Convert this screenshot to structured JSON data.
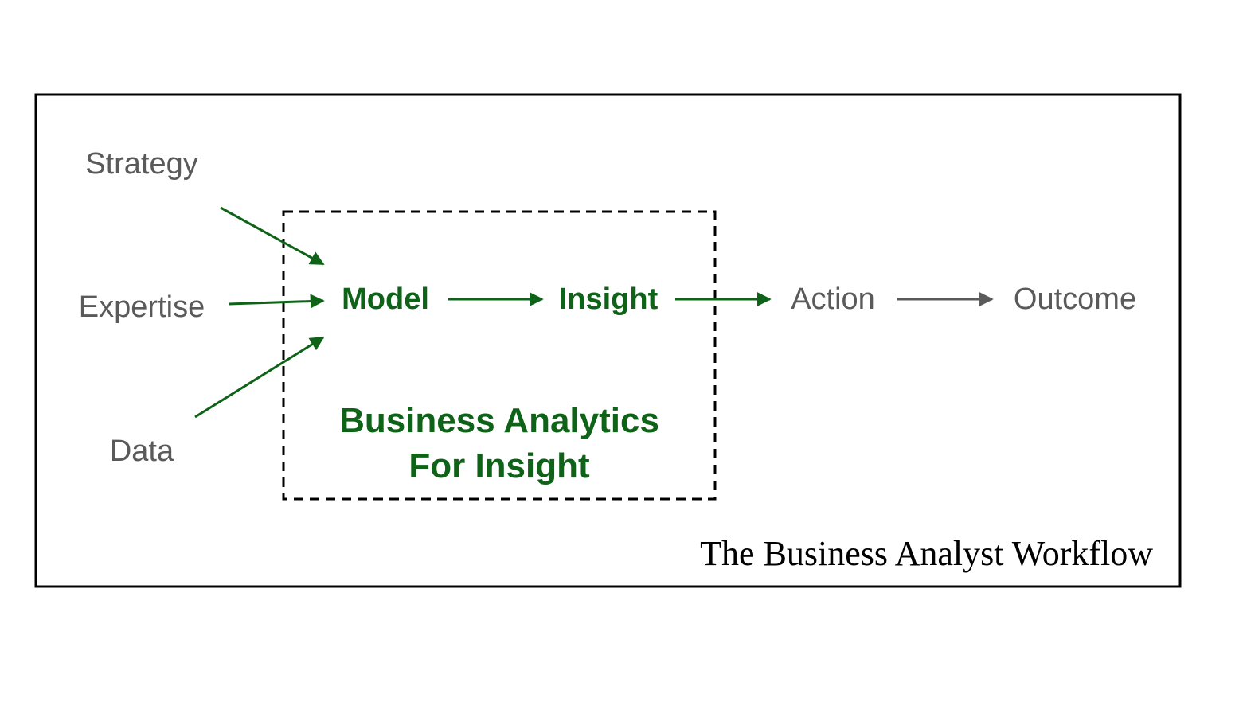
{
  "diagram": {
    "inputs": {
      "strategy": "Strategy",
      "expertise": "Expertise",
      "data": "Data"
    },
    "flow": {
      "model": "Model",
      "insight": "Insight",
      "action": "Action",
      "outcome": "Outcome"
    },
    "box_label": {
      "line1": "Business Analytics",
      "line2": "For Insight"
    },
    "caption": "The Business Analyst Workflow"
  },
  "colors": {
    "green": "#0f6318",
    "gray": "#5a5a5a",
    "black": "#000000"
  }
}
